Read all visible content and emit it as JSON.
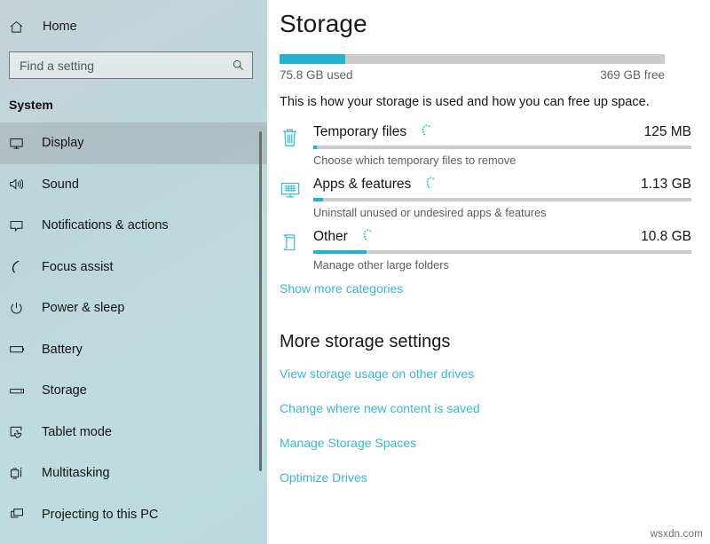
{
  "sidebar": {
    "home": {
      "label": "Home",
      "icon": "home-icon"
    },
    "search": {
      "placeholder": "Find a setting",
      "value": "",
      "icon": "search-icon"
    },
    "section_title": "System",
    "items": [
      {
        "label": "Display",
        "icon": "monitor-icon",
        "selected": true
      },
      {
        "label": "Sound",
        "icon": "speaker-icon",
        "selected": false
      },
      {
        "label": "Notifications & actions",
        "icon": "callout-icon",
        "selected": false
      },
      {
        "label": "Focus assist",
        "icon": "moon-icon",
        "selected": false
      },
      {
        "label": "Power & sleep",
        "icon": "power-icon",
        "selected": false
      },
      {
        "label": "Battery",
        "icon": "battery-icon",
        "selected": false
      },
      {
        "label": "Storage",
        "icon": "drive-icon",
        "selected": false
      },
      {
        "label": "Tablet mode",
        "icon": "tablet-touch-icon",
        "selected": false
      },
      {
        "label": "Multitasking",
        "icon": "multitasking-icon",
        "selected": false
      },
      {
        "label": "Projecting to this PC",
        "icon": "project-icon",
        "selected": false
      }
    ]
  },
  "main": {
    "title": "Storage",
    "overall_bar": {
      "used_label": "75.8 GB used",
      "free_label": "369 GB free",
      "fill_percent": 17
    },
    "intro": "This is how your storage is used and how you can free up space.",
    "categories": [
      {
        "name": "Temporary files",
        "size": "125 MB",
        "description": "Choose which temporary files to remove",
        "fill_percent": 1,
        "icon": "trash-icon",
        "spinner": "loading-spinner-icon"
      },
      {
        "name": "Apps & features",
        "size": "1.13 GB",
        "description": "Uninstall unused or undesired apps & features",
        "fill_percent": 2.5,
        "icon": "monitor-apps-icon",
        "spinner": "loading-spinner-icon"
      },
      {
        "name": "Other",
        "size": "10.8 GB",
        "description": "Manage other large folders",
        "fill_percent": 14,
        "icon": "folder-open-icon",
        "spinner": "loading-spinner-icon"
      }
    ],
    "show_more_label": "Show more categories",
    "more_heading": "More storage settings",
    "more_links": [
      "View storage usage on other drives",
      "Change where new content is saved",
      "Manage Storage Spaces",
      "Optimize Drives"
    ]
  },
  "watermark": "wsxdn.com",
  "colors": {
    "accent": "#1eb4cd",
    "link": "#3ab6d4",
    "sidebar_bg": "#bed8db",
    "track": "#cbcbcb"
  }
}
